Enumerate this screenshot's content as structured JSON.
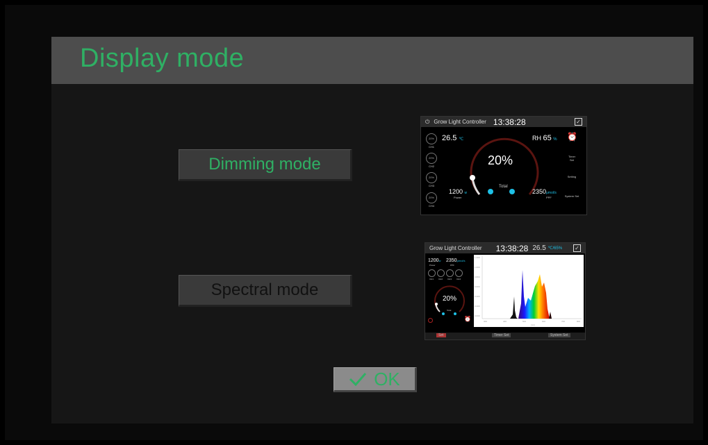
{
  "title": "Display mode",
  "buttons": {
    "dimming": "Dimming mode",
    "spectral": "Spectral mode",
    "ok": "OK"
  },
  "dimming_preview": {
    "header_title": "Grow Light Controller",
    "time": "13:38:28",
    "temperature": "26.5",
    "temperature_unit": "℃",
    "rh_label": "RH",
    "rh_value": "65",
    "rh_unit": "%",
    "big_percent": "20%",
    "total_label": "Total",
    "power_value": "1200",
    "power_unit": "w",
    "power_label": "Power",
    "ppf_value": "2350",
    "ppf_unit": "μmol/s",
    "ppf_label": "PPF",
    "channels": [
      {
        "pct": "20%",
        "label": "CH1"
      },
      {
        "pct": "20%",
        "label": "CH2"
      },
      {
        "pct": "20%",
        "label": "CH3"
      },
      {
        "pct": "20%",
        "label": "CH4"
      }
    ],
    "side_items": [
      "Timer Set",
      "Setting",
      "System Set"
    ]
  },
  "spectral_preview": {
    "header_title": "Grow Light Controller",
    "time": "13:38:28",
    "temperature": "26.5",
    "rh": "℃/65%",
    "power_value": "1200",
    "power_unit": "w",
    "power_label": "Power",
    "ppf_value": "2350",
    "ppf_unit": "μmol/s",
    "ppf_label": "PPF",
    "channel_labels": [
      "CH1",
      "CH2",
      "CH3",
      "CH4"
    ],
    "big_percent": "20%",
    "total_label": "Total",
    "y_ticks": [
      "1.200",
      "1.000",
      "0.800",
      "0.600",
      "0.400",
      "0.200",
      "0.000"
    ],
    "x_ticks": [
      "300",
      "400",
      "500",
      "600",
      "700",
      "800"
    ],
    "x_label": "(nm)",
    "bottom_items": [
      "Set",
      "Timer Set",
      "System Set"
    ]
  },
  "colors": {
    "accent_green": "#2fb064",
    "cyan": "#1ec0e6",
    "title_bar": "#4d4d4d",
    "background": "#161616"
  }
}
